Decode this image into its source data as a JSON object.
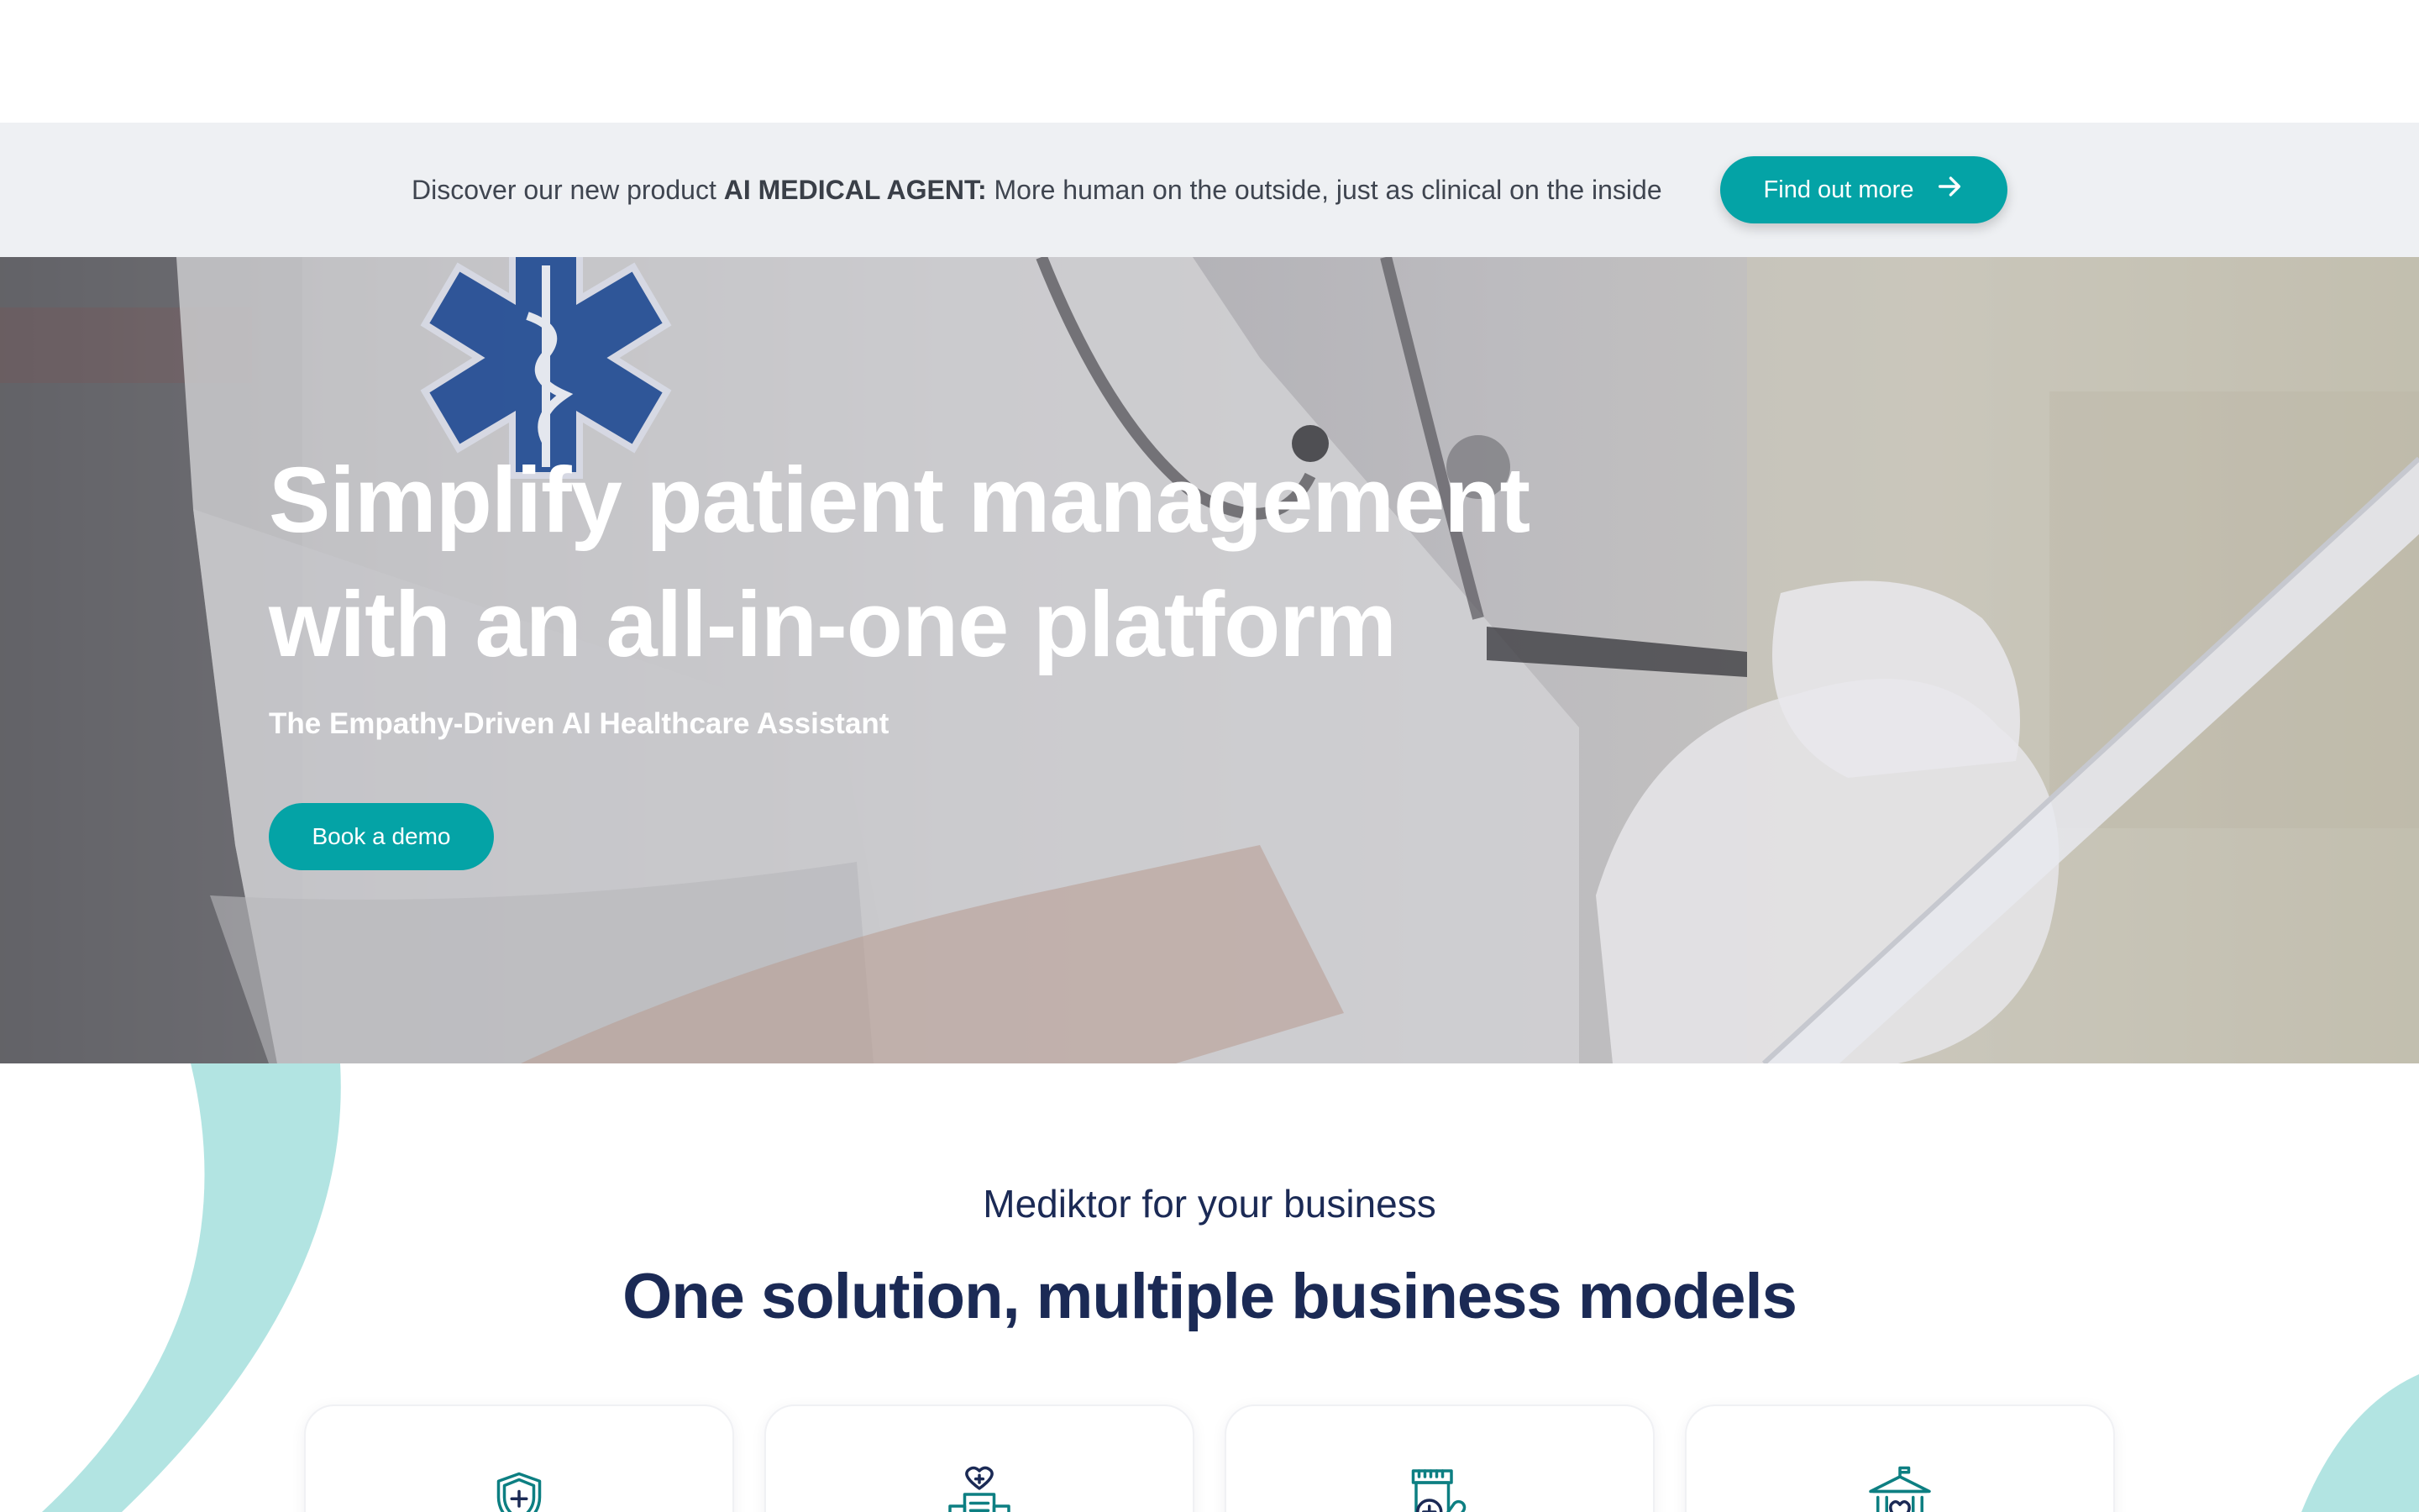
{
  "announcement": {
    "prefix": "Discover our new product ",
    "product": "AI MEDICAL AGENT:",
    "suffix": " More human on the outside, just as clinical on the inside",
    "cta_label": "Find out more",
    "cta_icon": "arrow-right-icon"
  },
  "hero": {
    "title_line1": "Simplify patient management",
    "title_line2": "with an all-in-one platform",
    "subtitle": "The Empathy-Driven AI Healthcare Assistant",
    "cta_label": "Book a demo"
  },
  "business": {
    "kicker": "Mediktor for your business",
    "title": "One solution, multiple business models",
    "cards": [
      {
        "icon": "shield-plus-icon"
      },
      {
        "icon": "hospital-building-icon"
      },
      {
        "icon": "pharmacy-icon"
      },
      {
        "icon": "public-building-icon"
      }
    ]
  },
  "colors": {
    "accent": "#04a3a6",
    "navy": "#1b2a55",
    "announce_bg": "#eef0f3",
    "decor_teal": "#b2e4e2"
  }
}
